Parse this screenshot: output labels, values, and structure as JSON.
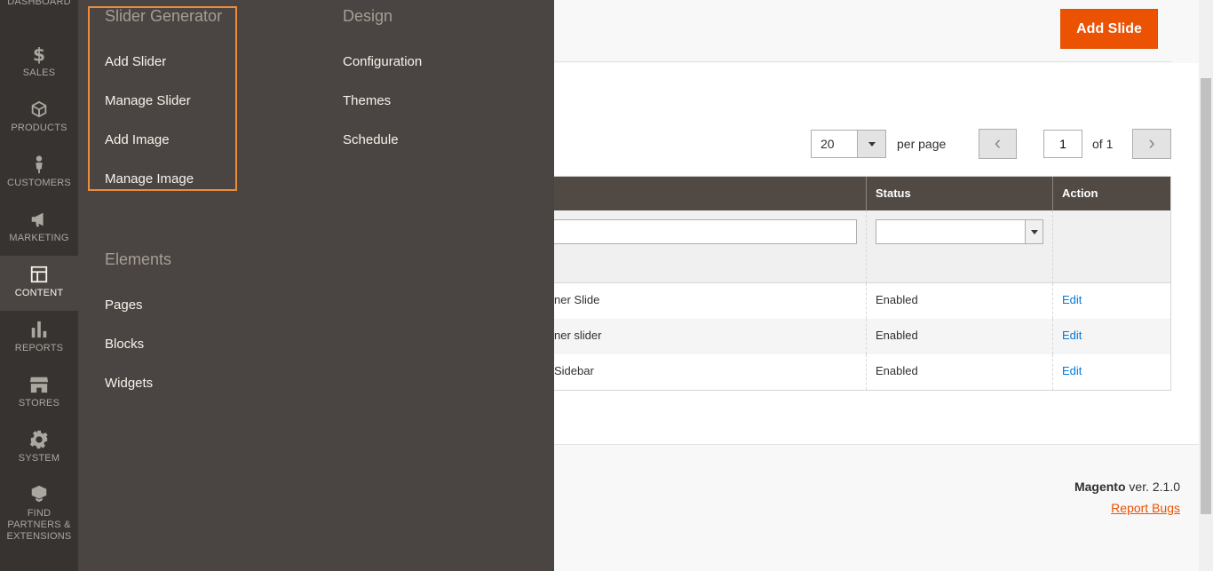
{
  "nav": {
    "items": [
      {
        "label": "DASHBOARD",
        "icon": "dashboard-icon"
      },
      {
        "label": "SALES",
        "icon": "dollar-icon"
      },
      {
        "label": "PRODUCTS",
        "icon": "cube-icon"
      },
      {
        "label": "CUSTOMERS",
        "icon": "person-icon"
      },
      {
        "label": "MARKETING",
        "icon": "megaphone-icon"
      },
      {
        "label": "CONTENT",
        "icon": "layout-icon",
        "active": true
      },
      {
        "label": "REPORTS",
        "icon": "bar-chart-icon"
      },
      {
        "label": "STORES",
        "icon": "storefront-icon"
      },
      {
        "label": "SYSTEM",
        "icon": "gear-icon"
      },
      {
        "label": "FIND PARTNERS & EXTENSIONS",
        "icon": "boxes-icon"
      }
    ]
  },
  "flyout": {
    "slider_generator": {
      "title": "Slider Generator",
      "links": [
        "Add Slider",
        "Manage Slider",
        "Add Image",
        "Manage Image"
      ]
    },
    "design": {
      "title": "Design",
      "links": [
        "Configuration",
        "Themes",
        "Schedule"
      ]
    },
    "elements": {
      "title": "Elements",
      "links": [
        "Pages",
        "Blocks",
        "Widgets"
      ]
    },
    "highlight_color": "#eb8d3c"
  },
  "header": {
    "add_button": "Add Slide",
    "accent_color": "#eb5202"
  },
  "pager": {
    "per_page_value": "20",
    "per_page_label": "per page",
    "current_page": "1",
    "of_label": "of 1",
    "prev_glyph": "‹",
    "next_glyph": "›"
  },
  "grid": {
    "columns": [
      "Status",
      "Action"
    ],
    "rows": [
      {
        "title": "ner Slide",
        "status": "Enabled",
        "action": "Edit"
      },
      {
        "title": "ner slider",
        "status": "Enabled",
        "action": "Edit"
      },
      {
        "title": "Sidebar",
        "status": "Enabled",
        "action": "Edit"
      }
    ]
  },
  "footer": {
    "brand": "Magento",
    "version": "ver. 2.1.0",
    "report_bugs": "Report Bugs"
  }
}
